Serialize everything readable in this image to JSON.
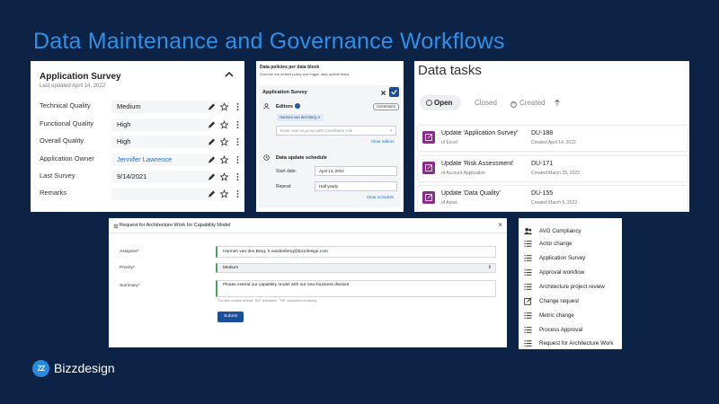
{
  "slide": {
    "title": "Data Maintenance and Governance Workflows"
  },
  "survey": {
    "title": "Application Survey",
    "subtitle": "Last updated April 14, 2022",
    "rows": [
      {
        "label": "Technical Quality",
        "value": "Medium"
      },
      {
        "label": "Functional Quality",
        "value": "High"
      },
      {
        "label": "Overall Quality",
        "value": "High"
      },
      {
        "label": "Application Owner",
        "value": "Jennifer Lawrence"
      },
      {
        "label": "Last Survey",
        "value": "9/14/2021"
      },
      {
        "label": "Remarks",
        "value": ""
      }
    ]
  },
  "policy": {
    "title": "Data policies per data block",
    "subtitle": "Override the default policy and trigger data update tasks",
    "block_name": "Application Survey",
    "editors_label": "Editors",
    "override_badge": "OVERRIDES",
    "editor_chip": "Harmen van den Berg",
    "editor_placeholder": "Enter user or group with Contributor role",
    "clear_editors": "Clear editors",
    "schedule_label": "Data update schedule",
    "start_label": "Start date:",
    "start_value": "April 14, 2022",
    "repeat_label": "Repeat:",
    "repeat_value": "Half yearly",
    "clear_schedule": "Clear schedule"
  },
  "tasks": {
    "title": "Data tasks",
    "tabs": {
      "open": "Open",
      "closed": "Closed",
      "created": "Created"
    },
    "items": [
      {
        "name": "Update 'Application Survey'",
        "of": "of Excel",
        "id": "DU-188",
        "date": "Created April 14, 2022"
      },
      {
        "name": "Update 'Risk Assessment'",
        "of": "of Account Application",
        "id": "DU-171",
        "date": "Created March 29, 2022"
      },
      {
        "name": "Update 'Data Quality'",
        "of": "of Asset",
        "id": "DU-155",
        "date": "Created March 6, 2022"
      }
    ],
    "accent": "#8a2c8a"
  },
  "request": {
    "title": "Request for Architecture Work for Capability Model",
    "assignee_label": "Assignee*",
    "assignee_value": "Harmen van den Berg, h.vandenberg@bizzdesign.com",
    "priority_label": "Priority*",
    "priority_value": "Medium",
    "summary_label": "Summary*",
    "summary_value": "Please extend our capability model with our new business division",
    "hint": "This text contains at least \"500\" characters, \"700\" characters remaining.",
    "submit": "Submit"
  },
  "workflows": {
    "items": [
      {
        "label": "AVG Compliancy",
        "icon": "users-icon"
      },
      {
        "label": "Actor change",
        "icon": "list-icon"
      },
      {
        "label": "Application Survey",
        "icon": "list-icon"
      },
      {
        "label": "Approval workflow",
        "icon": "list-icon"
      },
      {
        "label": "Architecture project review",
        "icon": "list-icon"
      },
      {
        "label": "Change request",
        "icon": "edit-icon"
      },
      {
        "label": "Metric change",
        "icon": "list-icon"
      },
      {
        "label": "Process Approval",
        "icon": "list-icon"
      },
      {
        "label": "Request for Architecture Work",
        "icon": "list-icon"
      }
    ]
  },
  "brand": {
    "name": "Bizzdesign",
    "mark": "ZZ",
    "accent": "#2a8ae0"
  }
}
